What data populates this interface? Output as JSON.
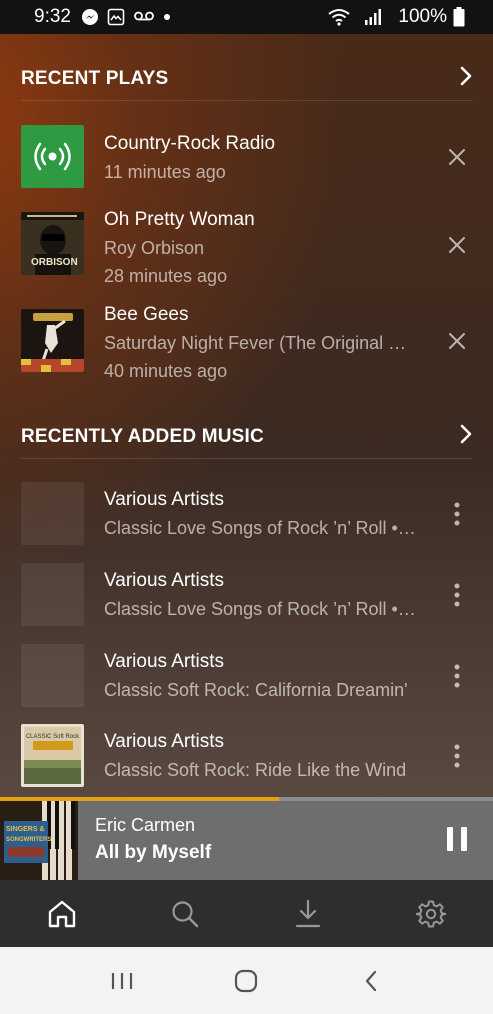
{
  "status_bar": {
    "time": "9:32",
    "battery": "100%",
    "icons": [
      "messenger-icon",
      "photo-icon",
      "voicemail-icon",
      "dot-icon",
      "wifi-icon",
      "signal-icon",
      "battery-icon"
    ]
  },
  "recent_plays": {
    "title": "RECENT PLAYS",
    "items": [
      {
        "title": "Country-Rock Radio",
        "subtitle": "",
        "time": "11 minutes ago",
        "thumb": "radio-icon"
      },
      {
        "title": "Oh Pretty Woman",
        "subtitle": "Roy Orbison",
        "time": "28 minutes ago",
        "thumb": "album-art-roy-orbison"
      },
      {
        "title": "Bee Gees",
        "subtitle": "Saturday Night Fever (The Original …",
        "time": "40 minutes ago",
        "thumb": "album-art-saturday-night-fever"
      }
    ]
  },
  "recently_added": {
    "title": "RECENTLY ADDED MUSIC",
    "items": [
      {
        "title": "Various Artists",
        "subtitle": "Classic Love Songs of Rock ’n’ Roll •…"
      },
      {
        "title": "Various Artists",
        "subtitle": "Classic Love Songs of Rock ’n’ Roll •…"
      },
      {
        "title": "Various Artists",
        "subtitle": "Classic Soft Rock: California Dreamin'"
      },
      {
        "title": "Various Artists",
        "subtitle": "Classic Soft Rock: Ride Like the Wind",
        "art_text": "CLASSIC Soft Rock"
      }
    ]
  },
  "player": {
    "artist": "Eric Carmen",
    "track": "All by Myself",
    "art_text": "SINGERS & SONGWRITERS",
    "progress": 0.565
  },
  "tabs": [
    "home-icon",
    "search-icon",
    "download-icon",
    "settings-icon"
  ],
  "colors": {
    "accent": "#e5a00d",
    "radio_green": "#2e9a42"
  }
}
